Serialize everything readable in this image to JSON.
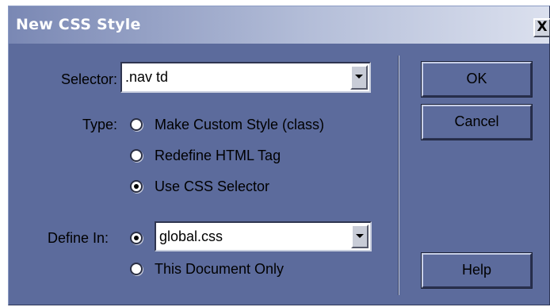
{
  "window": {
    "title": "New CSS Style",
    "close_label": "X"
  },
  "selector": {
    "label": "Selector:",
    "value": ".nav td"
  },
  "type": {
    "label": "Type:",
    "options": [
      {
        "label": "Make Custom Style (class)",
        "selected": false
      },
      {
        "label": "Redefine HTML Tag",
        "selected": false
      },
      {
        "label": "Use CSS Selector",
        "selected": true
      }
    ]
  },
  "define_in": {
    "label": "Define In:",
    "file_value": "global.css",
    "file_selected": true,
    "doc_only_label": "This Document Only",
    "doc_only_selected": false
  },
  "buttons": {
    "ok": "OK",
    "cancel": "Cancel",
    "help": "Help"
  },
  "icons": {
    "close": "close-icon",
    "dropdown": "chevron-down-icon"
  },
  "colors": {
    "dialog_bg": "#5c6b9c",
    "title_text": "#ffffff"
  }
}
